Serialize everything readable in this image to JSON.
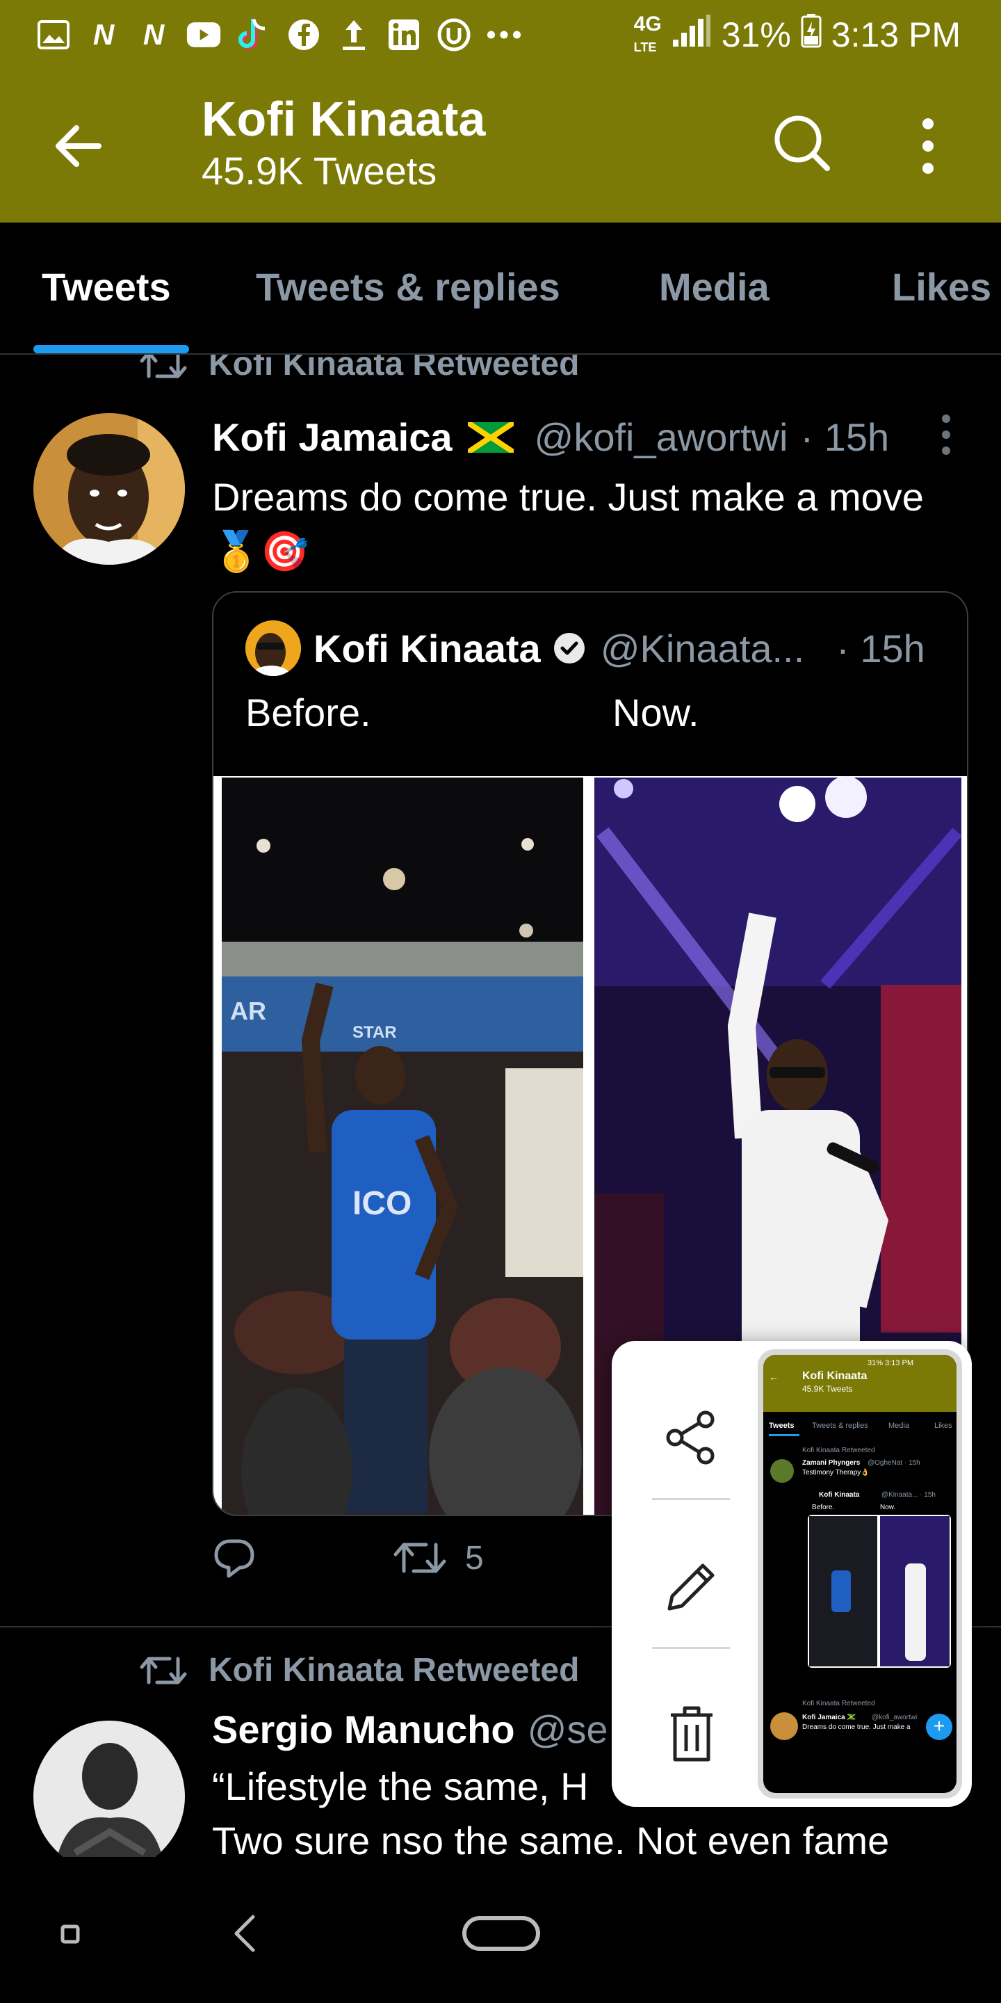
{
  "status_bar": {
    "network": "4G",
    "network_sub": "LTE",
    "battery": "31%",
    "time": "3:13 PM",
    "notification_icons": [
      "gallery-icon",
      "n-icon",
      "n-icon",
      "youtube-icon",
      "tiktok-icon",
      "facebook-icon",
      "upload-icon",
      "linkedin-icon",
      "u-icon",
      "more-notifications-icon"
    ]
  },
  "header": {
    "title": "Kofi Kinaata",
    "subtitle": "45.9K Tweets"
  },
  "tabs": [
    {
      "label": "Tweets",
      "active": true
    },
    {
      "label": "Tweets & replies",
      "active": false
    },
    {
      "label": "Media",
      "active": false
    },
    {
      "label": "Likes",
      "active": false
    }
  ],
  "tweet1": {
    "retweet_label": "Kofi Kinaata Retweeted",
    "name": "Kofi Jamaica",
    "handle": "@kofi_awortwi",
    "time": "· 15h",
    "text_line1": "Dreams do come true. Just make a move",
    "text_line2": "🥇🎯",
    "quote": {
      "name": "Kofi Kinaata",
      "handle": "@Kinaata...",
      "time": "· 15h",
      "text_left": "Before.",
      "text_right": "Now."
    },
    "retweet_count": "5"
  },
  "tweet2": {
    "retweet_label": "Kofi Kinaata Retweeted",
    "name": "Sergio Manucho",
    "handle": "@se",
    "text_line1": "“Lifestyle the same, H",
    "text_line2": "Two sure nso the same. Not even fame"
  },
  "popup": {
    "thumbnail": {
      "title": "Kofi Kinaata",
      "subtitle": "45.9K Tweets",
      "tabs": [
        "Tweets",
        "Tweets & replies",
        "Media",
        "Likes"
      ],
      "retweet_label": "Kofi Kinaata Retweeted",
      "tweet_name": "Zamani Phyngers",
      "tweet_handle": "@OgheNat · 15h",
      "tweet_text": "Testimony Therapy👌",
      "quote_name": "Kofi Kinaata",
      "quote_handle": "@Kinaata... · 15h",
      "quote_left": "Before.",
      "quote_right": "Now.",
      "retweet_label2": "Kofi Kinaata Retweeted",
      "tweet2_name": "Kofi Jamaica 🇯🇲",
      "tweet2_handle": "@kofi_awortwi",
      "tweet2_text": "Dreams do come true. Just make a",
      "status_time": "31% 3:13 PM"
    }
  },
  "colors": {
    "header_bg": "#7b7a06",
    "accent": "#1d9bf0",
    "muted_text": "#8b98a5"
  }
}
